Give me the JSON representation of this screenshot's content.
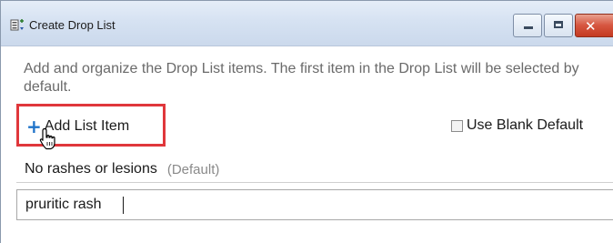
{
  "window": {
    "title": "Create Drop List",
    "icon": "drop-list-app-icon",
    "close_glyph": "✕"
  },
  "description": "Add and organize the Drop List items. The first item in the Drop List will be selected by default.",
  "toolbar": {
    "add_icon": "plus-icon",
    "add_label": "Add List Item",
    "blank_default_label": "Use Blank Default",
    "blank_default_checked": false
  },
  "list": {
    "items": [
      {
        "label": "No rashes or lesions",
        "tag": "(Default)"
      }
    ],
    "new_item_value": "pruritic rash"
  },
  "colors": {
    "highlight_box": "#e0373b",
    "plus_icon": "#1f73c9",
    "close_button": "#c43b22"
  }
}
